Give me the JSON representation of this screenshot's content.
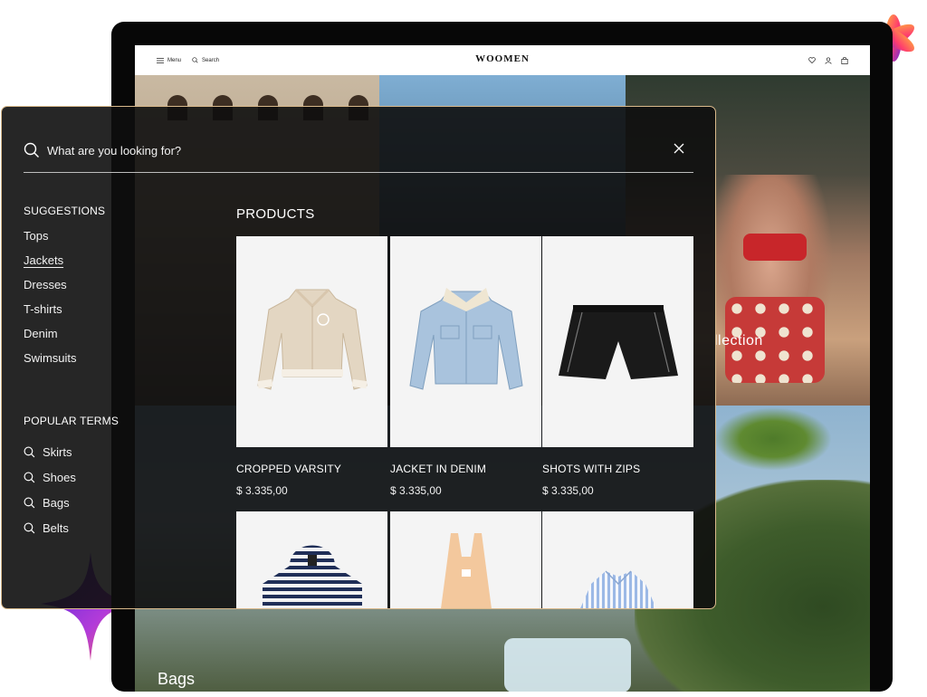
{
  "site": {
    "logo": "WOOMEN",
    "menu_label": "Menu",
    "search_label": "Search"
  },
  "hero": {
    "collection_text": "llection",
    "bags_label": "Bags"
  },
  "search": {
    "placeholder": "What are you looking for?"
  },
  "suggestions": {
    "title": "SUGGESTIONS",
    "items": [
      "Tops",
      "Jackets",
      "Dresses",
      "T-shirts",
      "Denim",
      "Swimsuits"
    ],
    "active_index": 1
  },
  "popular": {
    "title": "POPULAR TERMS",
    "items": [
      "Skirts",
      "Shoes",
      "Bags",
      "Belts"
    ]
  },
  "products": {
    "title": "PRODUCTS",
    "items": [
      {
        "name": "CROPPED VARSITY",
        "price": "$ 3.335,00"
      },
      {
        "name": "JACKET IN DENIM",
        "price": "$ 3.335,00"
      },
      {
        "name": "SHOTS WITH ZIPS",
        "price": "$ 3.335,00"
      }
    ]
  },
  "colors": {
    "overlay_border": "#d9b98b",
    "card_bg": "#f4f4f4"
  }
}
